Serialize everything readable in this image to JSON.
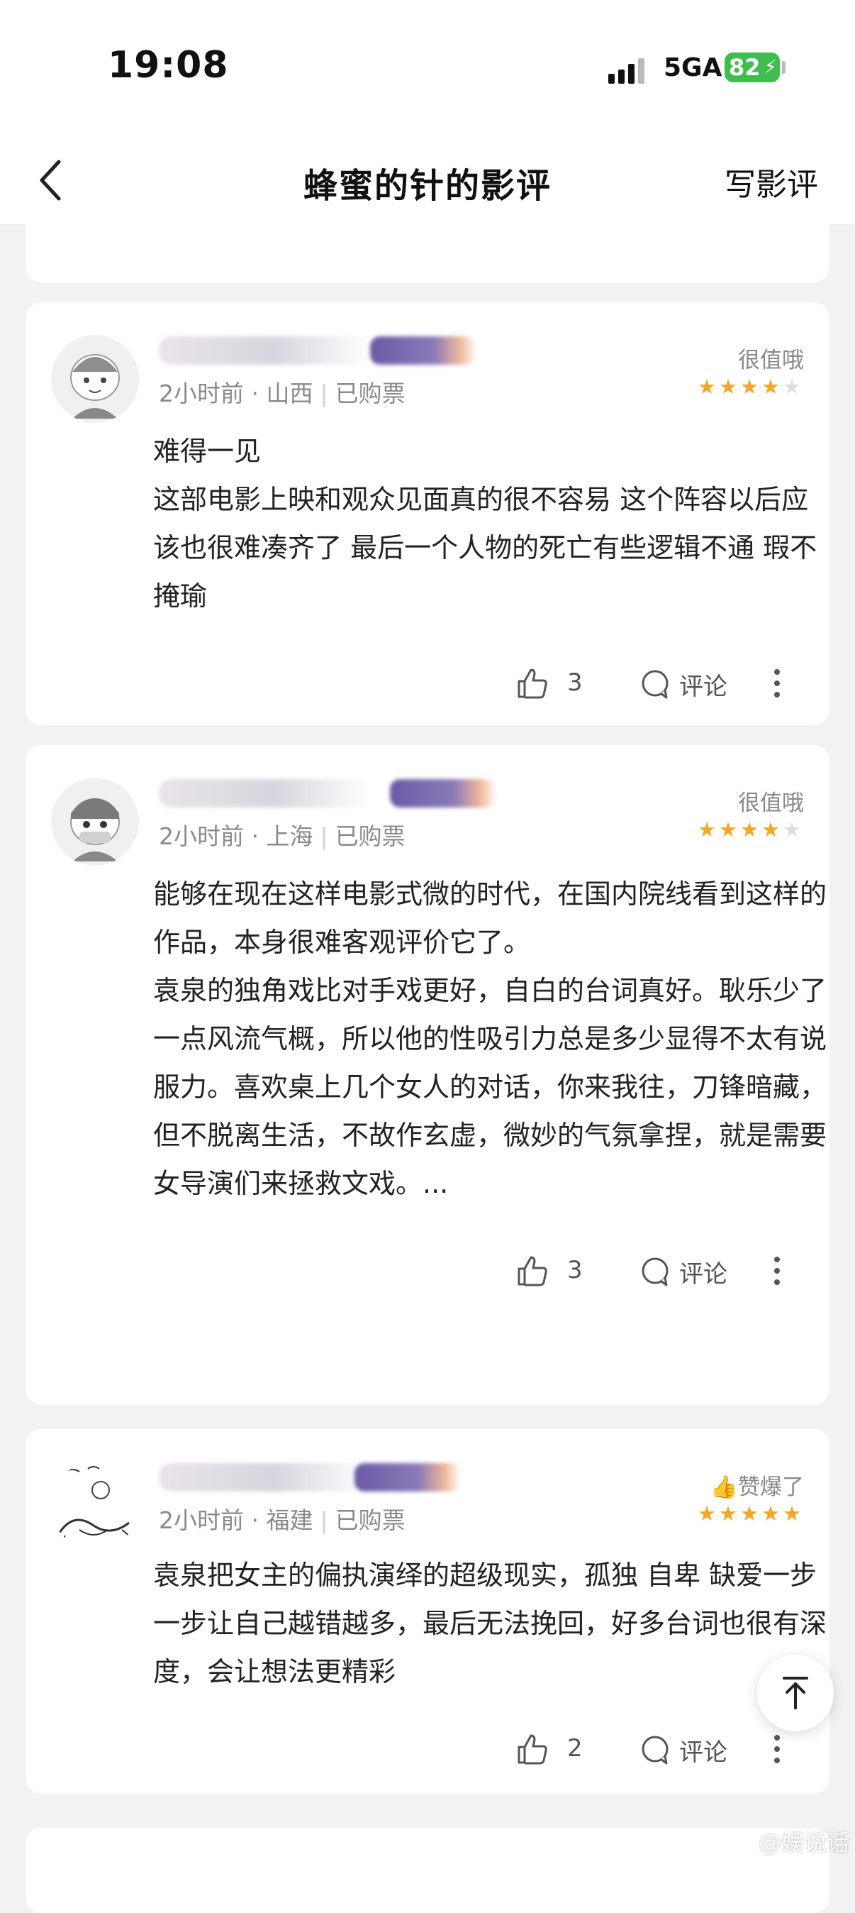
{
  "status_bar": {
    "time": "19:08",
    "network": "5GA",
    "battery": "82"
  },
  "nav": {
    "title": "蜂蜜的针的影评",
    "write_label": "写影评"
  },
  "reviews": [
    {
      "time_ago": "2小时前",
      "location": "山西",
      "purchase": "已购票",
      "rating_label": "很值哦",
      "stars": 4,
      "paragraphs": [
        "难得一见",
        "这部电影上映和观众见面真的很不容易 这个阵容以后应该也很难凑齐了 最后一个人物的死亡有些逻辑不通 瑕不掩瑜"
      ],
      "likes": "3",
      "comment_label": "评论"
    },
    {
      "time_ago": "2小时前",
      "location": "上海",
      "purchase": "已购票",
      "rating_label": "很值哦",
      "stars": 4,
      "paragraphs": [
        "能够在现在这样电影式微的时代，在国内院线看到这样的作品，本身很难客观评价它了。",
        "袁泉的独角戏比对手戏更好，自白的台词真好。耿乐少了一点风流气概，所以他的性吸引力总是多少显得不太有说服力。喜欢桌上几个女人的对话，你来我往，刀锋暗藏，但不脱离生活，不故作玄虚，微妙的气氛拿捏，就是需要女导演们来拯救文戏。..."
      ],
      "likes": "3",
      "comment_label": "评论"
    },
    {
      "time_ago": "2小时前",
      "location": "福建",
      "purchase": "已购票",
      "rating_label": "👍赞爆了",
      "stars": 5,
      "paragraphs": [
        "袁泉把女主的偏执演绎的超级现实，孤独 自卑  缺爱一步一步让自己越错越多，最后无法挽回，好多台词也很有深度，会让想法更精彩"
      ],
      "likes": "2",
      "comment_label": "评论"
    }
  ],
  "watermark": "@娱说话"
}
